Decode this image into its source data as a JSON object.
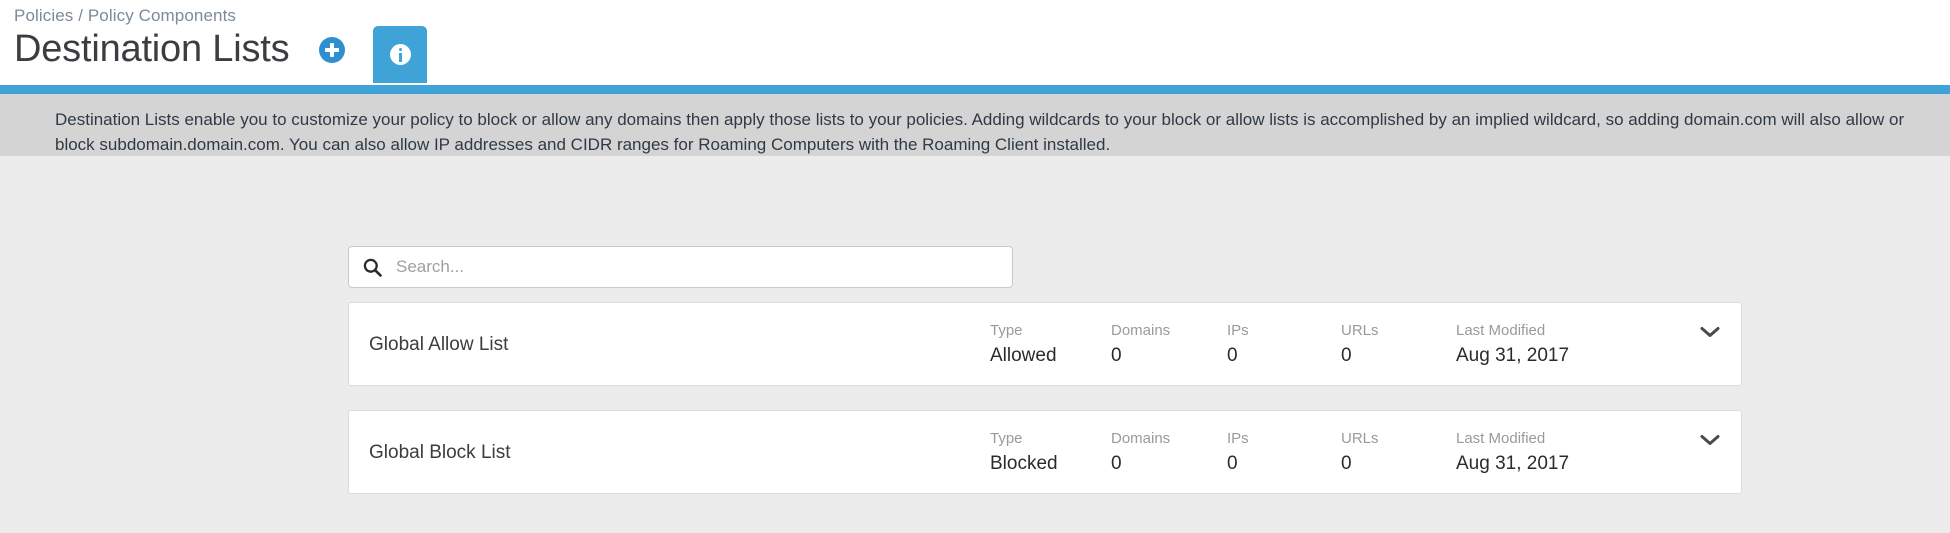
{
  "header": {
    "breadcrumb": "Policies / Policy Components",
    "title": "Destination Lists",
    "add_icon": "plus-circle-icon",
    "info_tab_icon": "info-icon",
    "accent_color": "#3fa3d8",
    "add_button_color": "#2f8fcf"
  },
  "info_banner": {
    "text": "Destination Lists enable you to customize your policy to block or allow any domains then apply those lists to your policies. Adding wildcards to your block or allow lists is accomplished by an implied wildcard, so adding domain.com will also allow or block subdomain.domain.com. You can also allow IP addresses and CIDR ranges for Roaming Computers with the Roaming Client installed.",
    "background_color": "#d4d4d4"
  },
  "search": {
    "icon": "search-icon",
    "placeholder": "Search...",
    "value": ""
  },
  "columns": {
    "type": "Type",
    "domains": "Domains",
    "ips": "IPs",
    "urls": "URLs",
    "last_modified": "Last Modified"
  },
  "destination_lists": [
    {
      "name": "Global Allow List",
      "type": "Allowed",
      "domains": "0",
      "ips": "0",
      "urls": "0",
      "last_modified": "Aug 31, 2017",
      "expand_icon": "chevron-down-icon"
    },
    {
      "name": "Global Block List",
      "type": "Blocked",
      "domains": "0",
      "ips": "0",
      "urls": "0",
      "last_modified": "Aug 31, 2017",
      "expand_icon": "chevron-down-icon"
    }
  ]
}
